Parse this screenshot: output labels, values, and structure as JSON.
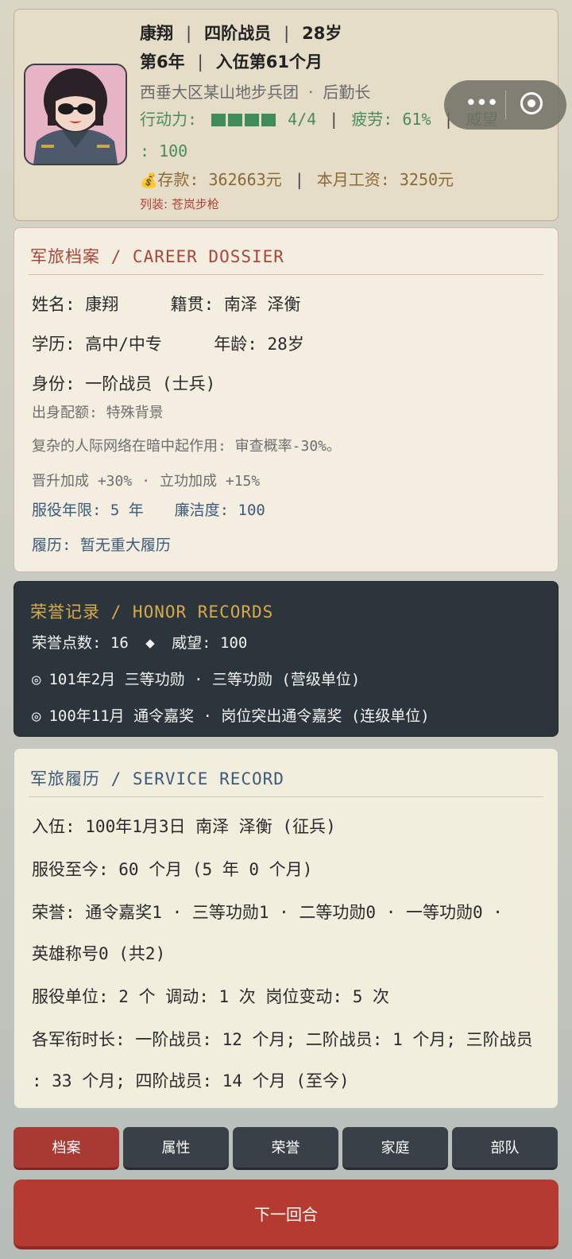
{
  "header": {
    "name": "康翔",
    "rank": "四阶战员",
    "age": "28岁",
    "year": "第6年",
    "month": "入伍第61个月",
    "unit": "西垂大区某山地步兵团",
    "position": "后勤长",
    "action_label": "行动力:",
    "action_value": "4/4",
    "action_level": 1.0,
    "fatigue": "疲劳: 61%",
    "prestige_label": "威望",
    "prestige_value": ": 100",
    "savings": "存款: 362663元",
    "salary": "本月工资: 3250元",
    "weapon": "列装: 苍岚步枪"
  },
  "dossier": {
    "title": "军旅档案 / CAREER DOSSIER",
    "name": "姓名: 康翔",
    "origin": "籍贯: 南泽 泽衡",
    "education": "学历: 高中/中专",
    "age": "年龄: 28岁",
    "identity": "身份: 一阶战员 (士兵)",
    "background": "出身配额: 特殊背景",
    "background_note": "复杂的人际网络在暗中起作用: 审查概率-30%。",
    "bonus1": "晋升加成 +30%",
    "bonus2": "立功加成 +15%",
    "service_years": "服役年限: 5 年",
    "integrity": "廉洁度: 100",
    "resume": "履历: 暂无重大履历"
  },
  "honor": {
    "title": "荣誉记录 / HONOR RECORDS",
    "points": "荣誉点数: 16",
    "prestige": "威望: 100",
    "records": [
      "101年2月 三等功勋 · 三等功勋 (营级单位)",
      "100年11月 通令嘉奖 · 岗位突出通令嘉奖 (连级单位)"
    ]
  },
  "service": {
    "title": "军旅履历 / SERVICE RECORD",
    "enlist": "入伍: 100年1月3日  南泽 泽衡  (征兵)",
    "duration": "服役至今: 60 个月 (5 年 0 个月)",
    "honors_line1": "荣誉: 通令嘉奖1 · 三等功勋1 · 二等功勋0 · 一等功勋0 ·",
    "honors_line2": "英雄称号0 (共2)",
    "units": "服役单位: 2 个  调动: 1 次  岗位变动: 5 次",
    "rank_time_line1": "各军衔时长: 一阶战员: 12 个月; 二阶战员: 1 个月; 三阶战员",
    "rank_time_line2": ": 33 个月; 四阶战员: 14 个月 (至今)"
  },
  "tabs": [
    "档案",
    "属性",
    "荣誉",
    "家庭",
    "部队"
  ],
  "next_button": "下一回合",
  "colors": {
    "accent_red": "#a83a33",
    "next_red": "#b53a2f",
    "dark_panel": "#2c353b",
    "honor_gold": "#d7aa4a",
    "green": "#4a8a5c"
  }
}
